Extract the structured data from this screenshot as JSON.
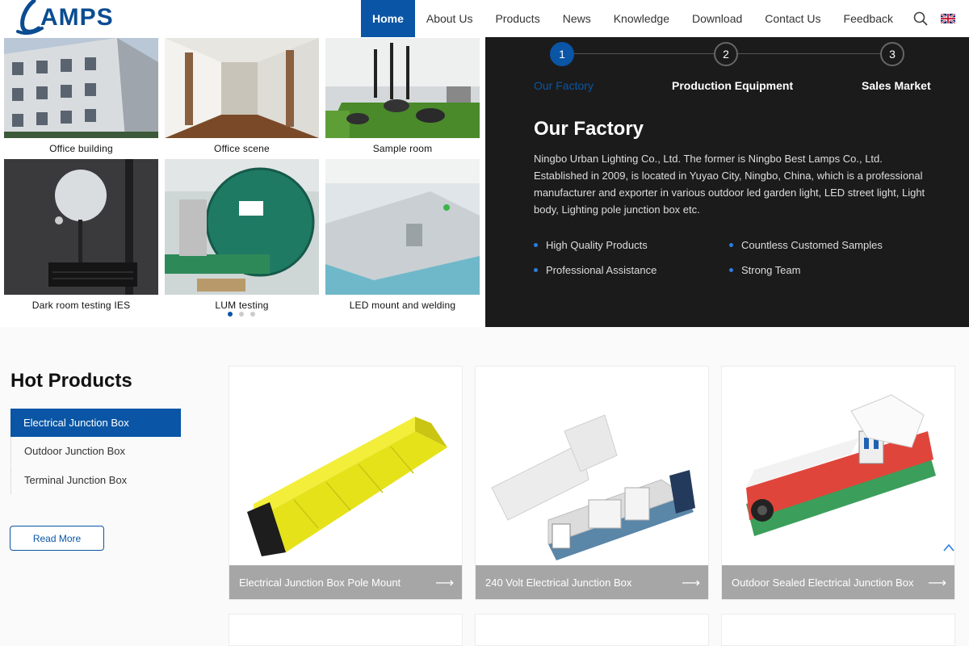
{
  "header": {
    "logo_text": "AMPS",
    "logo_initial": "L",
    "nav": [
      "Home",
      "About Us",
      "Products",
      "News",
      "Knowledge",
      "Download",
      "Contact Us",
      "Feedback"
    ],
    "active": "Home",
    "icons": [
      "search-icon",
      "uk-flag-icon"
    ]
  },
  "gallery": {
    "tiles": [
      {
        "caption": "Office building"
      },
      {
        "caption": "Office scene"
      },
      {
        "caption": "Sample room"
      },
      {
        "caption": "Dark room testing IES"
      },
      {
        "caption": "LUM testing"
      },
      {
        "caption": "LED mount and welding"
      }
    ],
    "page": 1,
    "pages": 3
  },
  "factory_panel": {
    "steps": [
      {
        "num": "1",
        "label": "Our Factory"
      },
      {
        "num": "2",
        "label": "Production Equipment"
      },
      {
        "num": "3",
        "label": "Sales Market"
      }
    ],
    "active_step": 1,
    "heading": "Our Factory",
    "body": "Ningbo Urban Lighting Co., Ltd. The former is Ningbo Best Lamps Co., Ltd. Established in 2009, is located in Yuyao City, Ningbo, China, which is a professional manufacturer and exporter in various outdoor led garden light, LED street light, Light body, Lighting pole junction box etc.",
    "features": [
      "High Quality Products",
      "Countless Customed Samples",
      "Professional Assistance",
      "Strong Team"
    ]
  },
  "hot_products": {
    "title": "Hot Products",
    "categories": [
      "Electrical Junction Box",
      "Outdoor Junction Box",
      "Terminal Junction Box"
    ],
    "active_category": "Electrical Junction Box",
    "read_more": "Read More",
    "products": [
      {
        "name": "Electrical Junction Box Pole Mount"
      },
      {
        "name": "240 Volt Electrical Junction Box"
      },
      {
        "name": "Outdoor Sealed Electrical Junction Box"
      }
    ]
  },
  "colors": {
    "brand": "#0a55a5",
    "panel_bg": "#1b1b1b",
    "bar_gray": "#a6a6a6"
  }
}
